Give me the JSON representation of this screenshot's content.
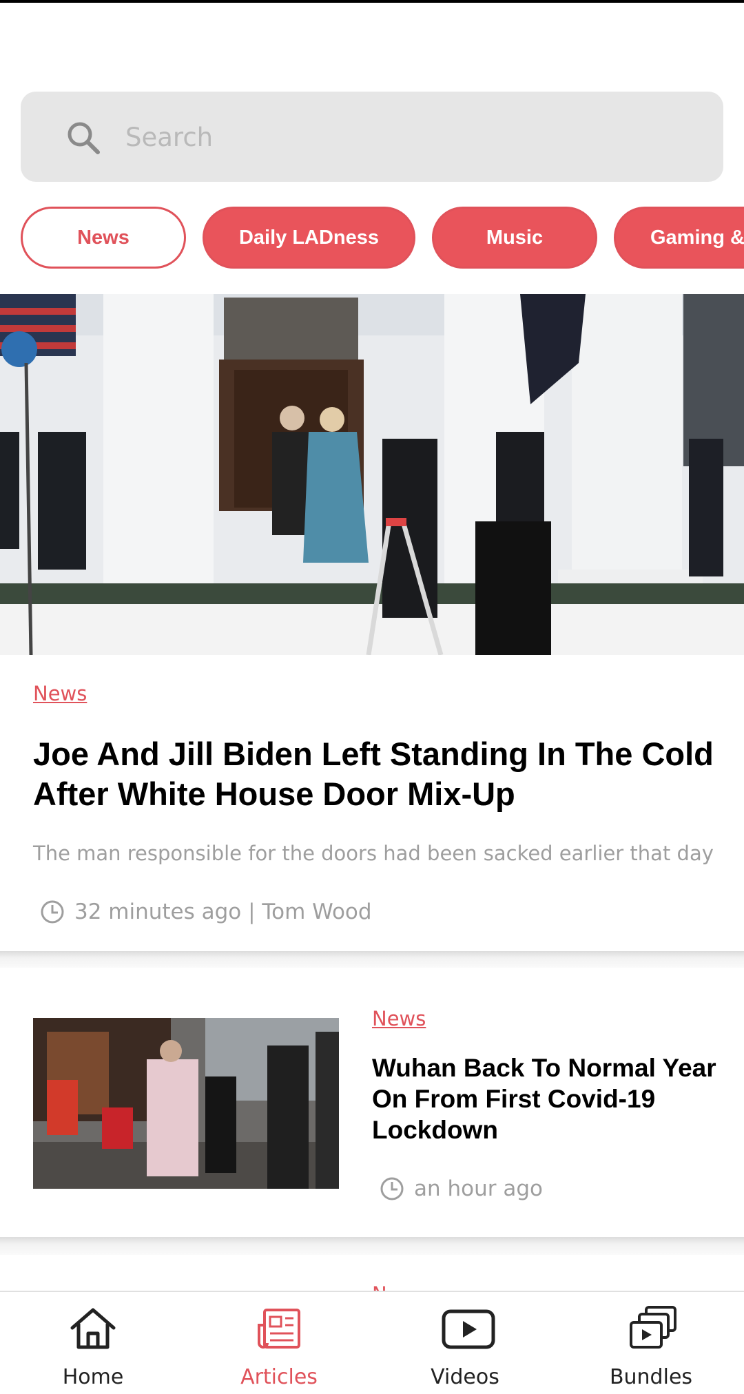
{
  "search": {
    "placeholder": "Search",
    "icon": "search-icon"
  },
  "categories": [
    {
      "label": "News",
      "active": true
    },
    {
      "label": "Daily LADness",
      "active": false
    },
    {
      "label": "Music",
      "active": false
    },
    {
      "label": "Gaming &",
      "active": false
    }
  ],
  "hero": {
    "category": "News",
    "title": "Joe And Jill Biden Left Standing In The Cold After White House Door Mix-Up",
    "subtitle": "The man responsible for the doors had been sacked earlier that day",
    "meta": "32 minutes ago | Tom Wood"
  },
  "articles": [
    {
      "category": "News",
      "title": "Wuhan Back To Normal Year On From First Covid-19 Lockdown",
      "meta": "an hour ago"
    }
  ],
  "bottom_nav": [
    {
      "label": "Home",
      "icon": "home-icon",
      "active": false
    },
    {
      "label": "Articles",
      "icon": "newspaper-icon",
      "active": true
    },
    {
      "label": "Videos",
      "icon": "play-icon",
      "active": false
    },
    {
      "label": "Bundles",
      "icon": "bundles-icon",
      "active": false
    }
  ],
  "colors": {
    "accent": "#e9545b",
    "text_muted": "#9e9e9e",
    "search_bg": "#e6e6e6"
  }
}
